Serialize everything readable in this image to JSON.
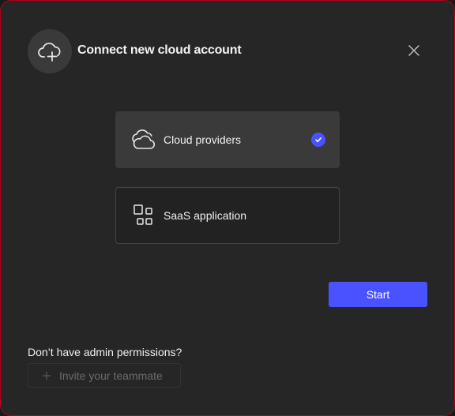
{
  "dialog": {
    "title": "Connect new cloud account",
    "header_icon": "cloud-plus-icon",
    "close_icon": "close-icon"
  },
  "options": [
    {
      "label": "Cloud providers",
      "icon": "cloud-icon",
      "selected": true
    },
    {
      "label": "SaaS application",
      "icon": "apps-grid-icon",
      "selected": false
    }
  ],
  "actions": {
    "start_label": "Start"
  },
  "footer": {
    "permissions_text": "Don’t have admin permissions?",
    "invite_label": "Invite your teammate",
    "invite_icon": "plus-icon",
    "invite_disabled": true
  },
  "colors": {
    "accent": "#4a51ff",
    "background": "#262626",
    "selected_option": "#3a3a3a",
    "border_highlight": "#b3001b"
  }
}
